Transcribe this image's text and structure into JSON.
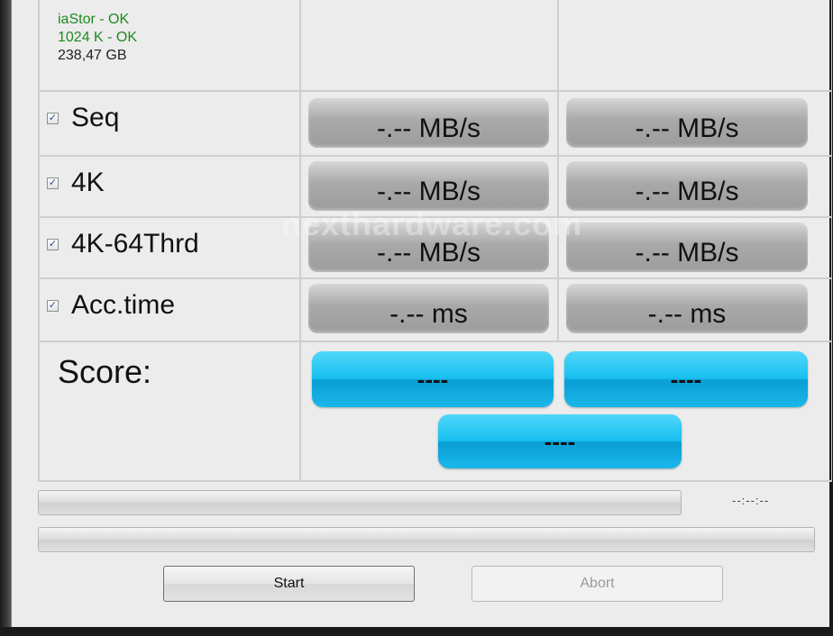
{
  "drive_info": {
    "driver": "iaStor - OK",
    "alignment": "1024 K - OK",
    "capacity": "238,47 GB"
  },
  "rows": [
    {
      "label": "Seq",
      "checked": true,
      "read": "-.-- MB/s",
      "write": "-.-- MB/s"
    },
    {
      "label": "4K",
      "checked": true,
      "read": "-.-- MB/s",
      "write": "-.-- MB/s"
    },
    {
      "label": "4K-64Thrd",
      "checked": true,
      "read": "-.-- MB/s",
      "write": "-.-- MB/s"
    },
    {
      "label": "Acc.time",
      "checked": true,
      "read": "-.-- ms",
      "write": "-.-- ms"
    }
  ],
  "score": {
    "label": "Score:",
    "read": "----",
    "write": "----",
    "total": "----"
  },
  "elapsed_time": "--:--:--",
  "buttons": {
    "start": "Start",
    "abort": "Abort"
  },
  "watermark": "nexthardware.com",
  "colors": {
    "ok_text": "#1f8a1f",
    "score_accent": "#19bff0",
    "result_pill": "#a9a9a9"
  }
}
